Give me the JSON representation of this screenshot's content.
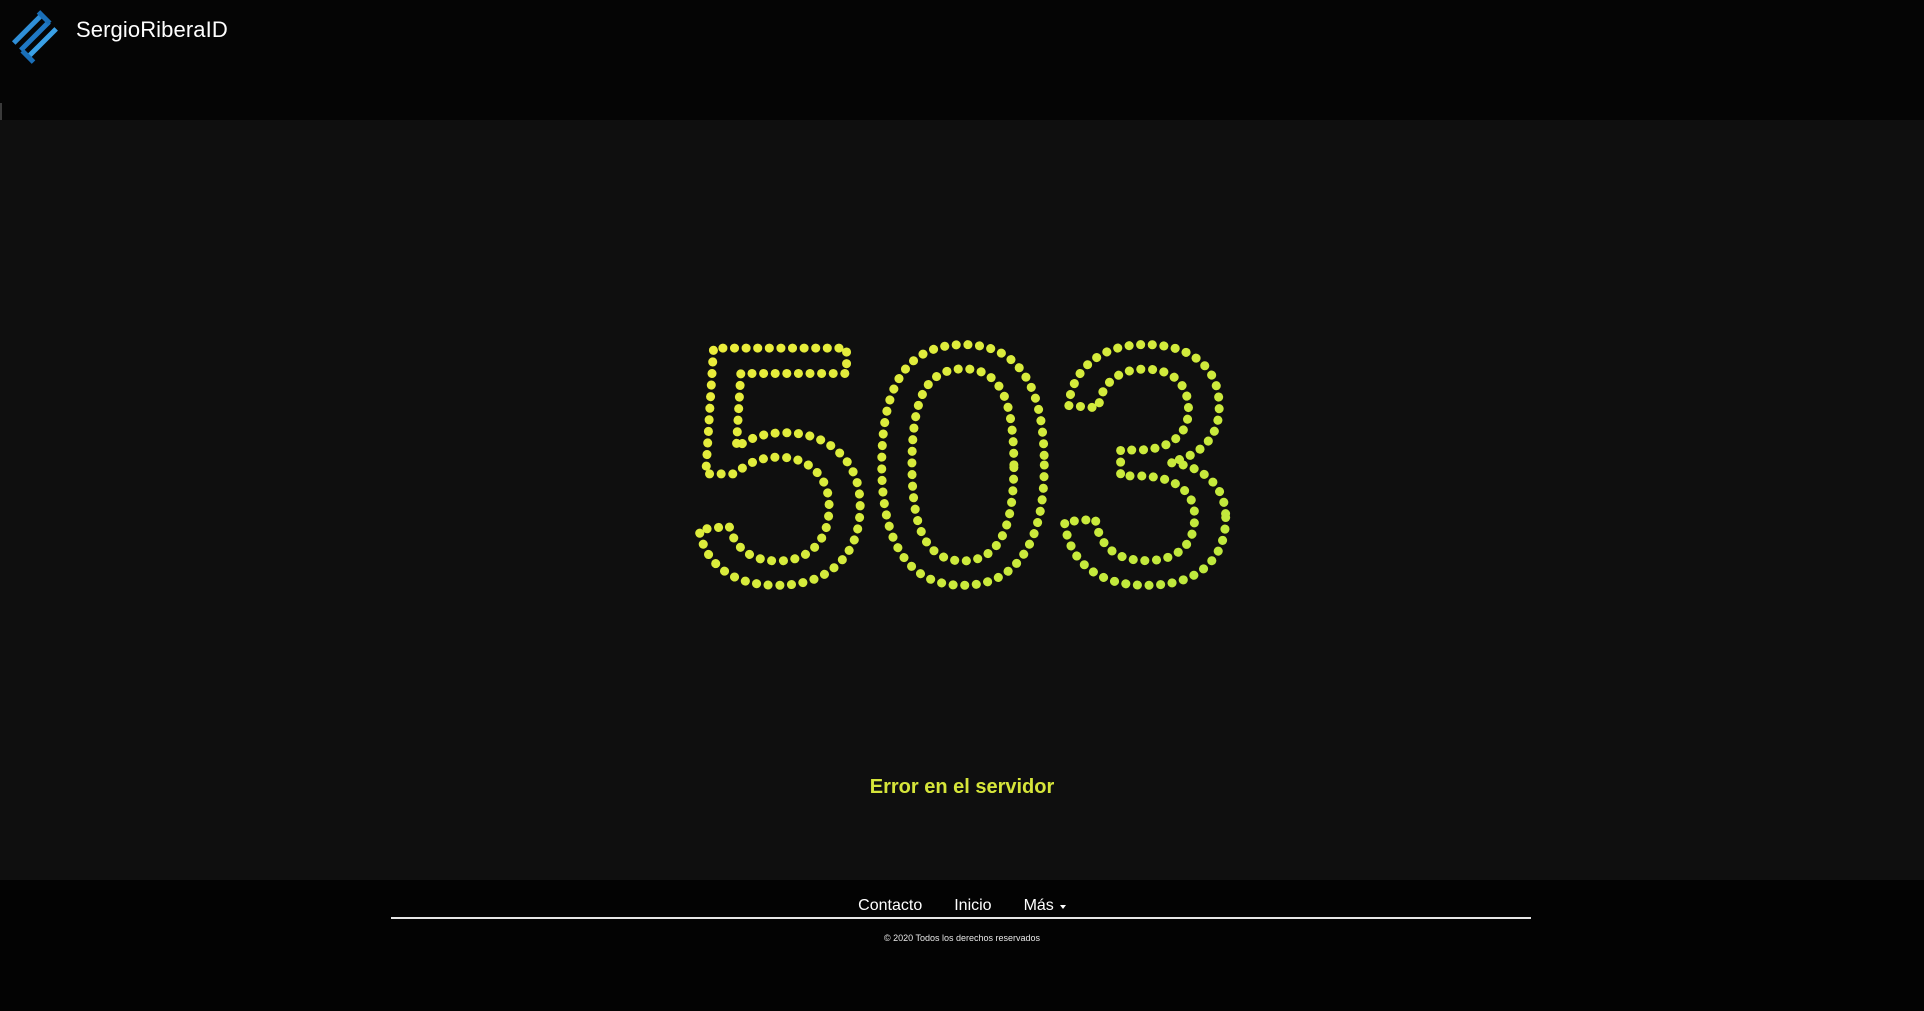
{
  "header": {
    "brand_name": "SergioRiberaID",
    "logo_icon": "sergioriberaid-logo-icon"
  },
  "main": {
    "error_code": "503",
    "error_message": "Error en el servidor",
    "dot_color_primary": "#f0ec3a",
    "dot_color_secondary": "#b8e83c"
  },
  "footer": {
    "nav": [
      {
        "label": "Contacto"
      },
      {
        "label": "Inicio"
      },
      {
        "label": "Más",
        "icon": "caret-down-icon"
      }
    ],
    "copyright": "© 2020 Todos los derechos reservados"
  }
}
